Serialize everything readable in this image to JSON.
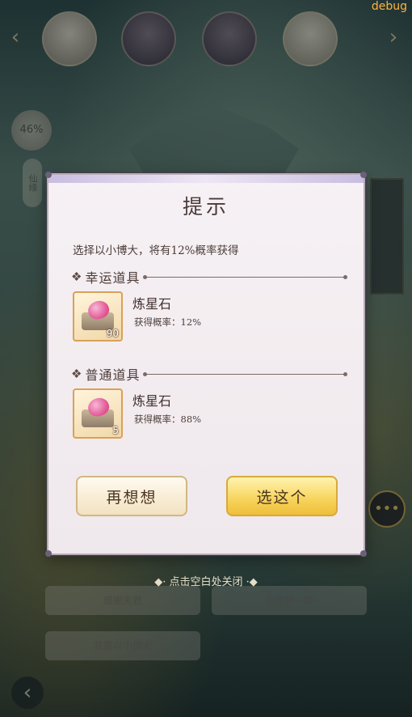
{
  "debug_label": "debug",
  "background": {
    "portraits": [
      "",
      "",
      "",
      ""
    ],
    "progress_badge": "46%",
    "side_tag": "仙缘",
    "options": [
      "感谢夫君",
      "我想静一静",
      "我要以小博大"
    ],
    "close_hint": "点击空白处关闭"
  },
  "dialog": {
    "title": "提示",
    "description": "选择以小博大，将有12%概率获得",
    "lucky_section": {
      "label": "幸运道具",
      "item": {
        "name": "炼星石",
        "rate_label": "获得概率：",
        "rate": "12%",
        "count": "90"
      }
    },
    "normal_section": {
      "label": "普通道具",
      "item": {
        "name": "炼星石",
        "rate_label": "获得概率：",
        "rate": "88%",
        "count": "5"
      }
    },
    "cancel_label": "再想想",
    "confirm_label": "选这个"
  },
  "icons": {
    "nav_left": "chevron-left-icon",
    "nav_right": "chevron-right-icon",
    "chat": "chat-bubble-icon",
    "back": "back-arrow-icon",
    "section_marker": "diamond-icon"
  },
  "colors": {
    "dialog_bg": "#f6f1f4",
    "confirm_button": "#f7d35a",
    "cancel_button": "#f2e2c0",
    "rarity_frame": "#d9a05a"
  }
}
